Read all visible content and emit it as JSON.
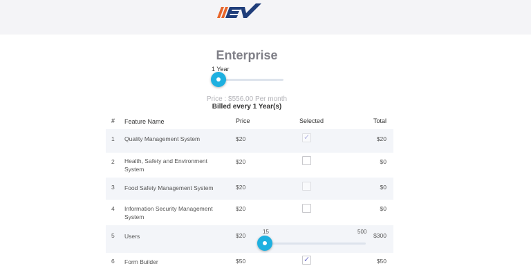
{
  "header": {
    "logo_text": "EV",
    "logo_icon": "ev-logo-icon"
  },
  "plan": {
    "title": "Enterprise",
    "period_label": "1 Year",
    "period_slider_fraction": 0.0,
    "price_text": "Price : $556.00 Per month",
    "billed_text": "Billed every 1 Year(s)"
  },
  "table": {
    "headers": {
      "num": "#",
      "name": "Feature Name",
      "price": "Price",
      "selected": "Selected",
      "total": "Total"
    },
    "rows": [
      {
        "num": "1",
        "name": "Quality Management System",
        "price": "$20",
        "selected": true,
        "enabled": false,
        "total": "$20"
      },
      {
        "num": "2",
        "name": "Health, Safety and Environment System",
        "price": "$20",
        "selected": false,
        "enabled": true,
        "total": "$0"
      },
      {
        "num": "3",
        "name": "Food Safety Management System",
        "price": "$20",
        "selected": false,
        "enabled": false,
        "total": "$0"
      },
      {
        "num": "4",
        "name": "Information Security Management System",
        "price": "$20",
        "selected": false,
        "enabled": true,
        "total": "$0"
      },
      {
        "num": "5",
        "name": "Users",
        "price": "$20",
        "slider_min": "15",
        "slider_max": "500",
        "slider_value": 15,
        "total": "$300"
      },
      {
        "num": "6",
        "name": "Form Builder",
        "price": "$50",
        "selected": true,
        "enabled": true,
        "total": "$50"
      }
    ]
  },
  "colors": {
    "accent": "#1eb0e0",
    "logo_orange": "#e8652a",
    "logo_navy": "#1f3d7a",
    "header_bg": "#f4f4f7"
  }
}
